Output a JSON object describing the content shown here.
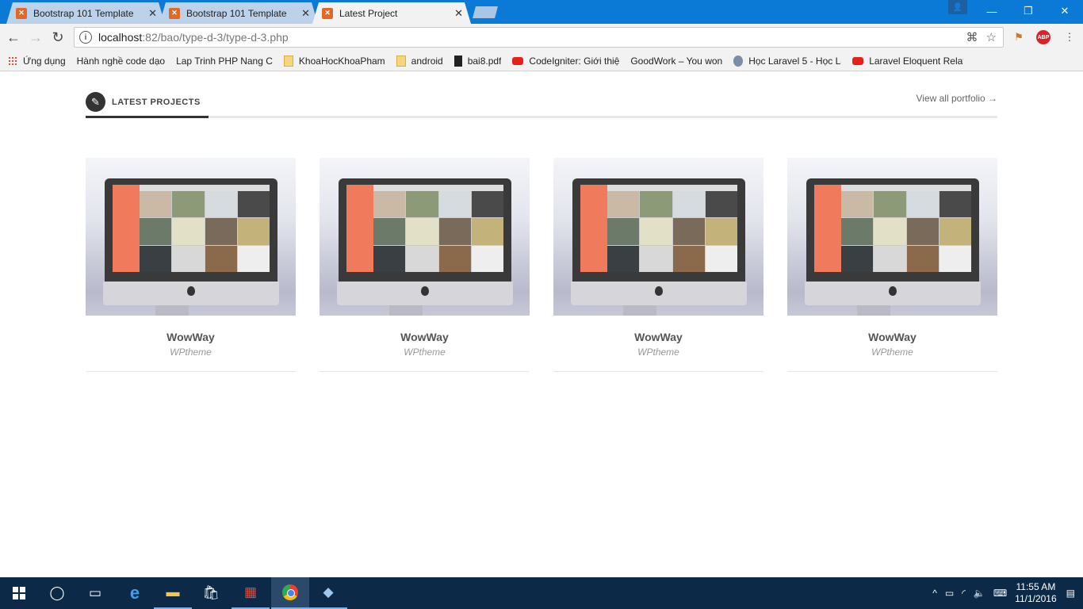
{
  "browser": {
    "tabs": [
      {
        "title": "Bootstrap 101 Template",
        "active": false
      },
      {
        "title": "Bootstrap 101 Template",
        "active": false
      },
      {
        "title": "Latest Project",
        "active": true
      }
    ],
    "url_host": "localhost",
    "url_path": ":82/bao/type-d-3/type-d-3.php",
    "bookmarks": [
      {
        "label": "Ứng dụng",
        "icon": "apps-icon"
      },
      {
        "label": "Hành nghề code dạo",
        "icon": "page-icon"
      },
      {
        "label": "Lap Trinh PHP Nang C",
        "icon": "page-icon"
      },
      {
        "label": "KhoaHocKhoaPham",
        "icon": "folder-icon"
      },
      {
        "label": "android",
        "icon": "folder-icon"
      },
      {
        "label": "bai8.pdf",
        "icon": "pdf-icon"
      },
      {
        "label": "CodeIgniter: Giới thiệ",
        "icon": "youtube-icon"
      },
      {
        "label": "GoodWork – You won",
        "icon": "page-icon"
      },
      {
        "label": "Học Laravel 5 - Học La",
        "icon": "gear-icon"
      },
      {
        "label": "Laravel Eloquent Relat",
        "icon": "youtube-icon"
      }
    ]
  },
  "section": {
    "title": "LATEST PROJECTS",
    "view_all": "View all portfolio →"
  },
  "projects": [
    {
      "title": "WowWay",
      "subtitle": "WPtheme"
    },
    {
      "title": "WowWay",
      "subtitle": "WPtheme"
    },
    {
      "title": "WowWay",
      "subtitle": "WPtheme"
    },
    {
      "title": "WowWay",
      "subtitle": "WPtheme"
    }
  ],
  "taskbar": {
    "time": "11:55 AM",
    "date": "11/1/2016"
  }
}
